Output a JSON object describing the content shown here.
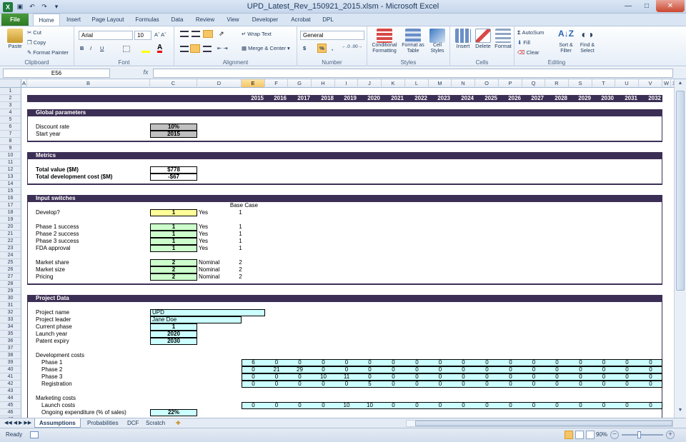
{
  "window": {
    "title": "UPD_Latest_Rev_150921_2015.xlsm - Microsoft Excel"
  },
  "ribbon": {
    "tabs": [
      "File",
      "Home",
      "Insert",
      "Page Layout",
      "Formulas",
      "Data",
      "Review",
      "View",
      "Developer",
      "Acrobat",
      "DPL"
    ],
    "clipboard": {
      "label": "Clipboard",
      "paste": "Paste",
      "cut": "Cut",
      "copy": "Copy",
      "format_painter": "Format Painter"
    },
    "font": {
      "label": "Font",
      "name": "Arial",
      "size": "10",
      "bold": "B",
      "italic": "I",
      "underline": "U"
    },
    "alignment": {
      "label": "Alignment",
      "wrap": "Wrap Text",
      "merge": "Merge & Center"
    },
    "number": {
      "label": "Number",
      "format": "General",
      "currency": "$",
      "percent": "%",
      "comma": ","
    },
    "styles": {
      "label": "Styles",
      "conditional": "Conditional Formatting",
      "table": "Format as Table",
      "cell": "Cell Styles"
    },
    "cells": {
      "label": "Cells",
      "insert": "Insert",
      "delete": "Delete",
      "format": "Format"
    },
    "editing": {
      "label": "Editing",
      "autosum": "AutoSum",
      "fill": "Fill",
      "clear": "Clear",
      "sort": "Sort & Filter",
      "find": "Find & Select"
    }
  },
  "formula_bar": {
    "name_box": "E56",
    "fx": "fx",
    "formula": ""
  },
  "columns": [
    "A",
    "B",
    "C",
    "D",
    "E",
    "F",
    "G",
    "H",
    "I",
    "J",
    "K",
    "L",
    "M",
    "N",
    "O",
    "P",
    "Q",
    "R",
    "S",
    "T",
    "U",
    "V",
    "W",
    "X"
  ],
  "rows": [
    "1",
    "2",
    "3",
    "4",
    "5",
    "6",
    "7",
    "8",
    "9",
    "10",
    "11",
    "12",
    "13",
    "14",
    "15",
    "16",
    "17",
    "18",
    "19",
    "20",
    "21",
    "22",
    "23",
    "24",
    "25",
    "26",
    "27",
    "28",
    "29",
    "30",
    "31",
    "32",
    "33",
    "34",
    "35",
    "36",
    "37",
    "38",
    "39",
    "40",
    "41",
    "42",
    "43",
    "44",
    "45",
    "46",
    "47"
  ],
  "years": [
    "2015",
    "2016",
    "2017",
    "2018",
    "2019",
    "2020",
    "2021",
    "2022",
    "2023",
    "2024",
    "2025",
    "2026",
    "2027",
    "2028",
    "2029",
    "2030",
    "2031",
    "2032"
  ],
  "sections": {
    "global": "Global parameters",
    "metrics": "Metrics",
    "inputs": "Input switches",
    "project": "Project Data"
  },
  "global": {
    "discount_label": "Discount rate",
    "discount_value": "10%",
    "start_label": "Start year",
    "start_value": "2015"
  },
  "metrics": {
    "value_label": "Total value ($M)",
    "value": "$778",
    "cost_label": "Total development cost ($M)",
    "cost": "-$67"
  },
  "inputs": {
    "base_case_header": "Base Case",
    "rows": [
      {
        "label": "Develop?",
        "value": "1",
        "desc": "Yes",
        "base": "1"
      },
      {
        "label": "Phase 1 success",
        "value": "1",
        "desc": "Yes",
        "base": "1"
      },
      {
        "label": "Phase 2 success",
        "value": "1",
        "desc": "Yes",
        "base": "1"
      },
      {
        "label": "Phase 3 success",
        "value": "1",
        "desc": "Yes",
        "base": "1"
      },
      {
        "label": "FDA approval",
        "value": "1",
        "desc": "Yes",
        "base": "1"
      },
      {
        "label": "Market share",
        "value": "2",
        "desc": "Nominal",
        "base": "2"
      },
      {
        "label": "Market size",
        "value": "2",
        "desc": "Nominal",
        "base": "2"
      },
      {
        "label": "Pricing",
        "value": "2",
        "desc": "Nominal",
        "base": "2"
      }
    ]
  },
  "project": {
    "name_label": "Project name",
    "name": "UPD",
    "leader_label": "Project leader",
    "leader": "Jane Doe",
    "phase_label": "Current phase",
    "phase": "1",
    "launch_label": "Launch year",
    "launch": "2020",
    "patent_label": "Patent expiry",
    "patent": "2030",
    "devcost_label": "Development costs",
    "dev_rows": [
      {
        "label": "Phase 1",
        "values": [
          "6",
          "0",
          "0",
          "0",
          "0",
          "0",
          "0",
          "0",
          "0",
          "0",
          "0",
          "0",
          "0",
          "0",
          "0",
          "0",
          "0",
          "0"
        ]
      },
      {
        "label": "Phase 2",
        "values": [
          "0",
          "21",
          "29",
          "0",
          "0",
          "0",
          "0",
          "0",
          "0",
          "0",
          "0",
          "0",
          "0",
          "0",
          "0",
          "0",
          "0",
          "0"
        ]
      },
      {
        "label": "Phase 3",
        "values": [
          "0",
          "0",
          "0",
          "10",
          "11",
          "0",
          "0",
          "0",
          "0",
          "0",
          "0",
          "0",
          "0",
          "0",
          "0",
          "0",
          "0",
          "0"
        ]
      },
      {
        "label": "Registration",
        "values": [
          "0",
          "0",
          "0",
          "0",
          "0",
          "5",
          "0",
          "0",
          "0",
          "0",
          "0",
          "0",
          "0",
          "0",
          "0",
          "0",
          "0",
          "0"
        ]
      }
    ],
    "mkt_label": "Marketing costs",
    "launch_costs_label": "Launch costs",
    "launch_costs": [
      "0",
      "0",
      "0",
      "0",
      "10",
      "10",
      "0",
      "0",
      "0",
      "0",
      "0",
      "0",
      "0",
      "0",
      "0",
      "0",
      "0",
      "0"
    ],
    "ongoing_label": "Ongoing expenditure (% of sales)",
    "ongoing": "22%"
  },
  "sheets": [
    "Assumptions",
    "Probabilities",
    "DCF",
    "Scratch"
  ],
  "status": {
    "ready": "Ready",
    "zoom": "90%"
  }
}
